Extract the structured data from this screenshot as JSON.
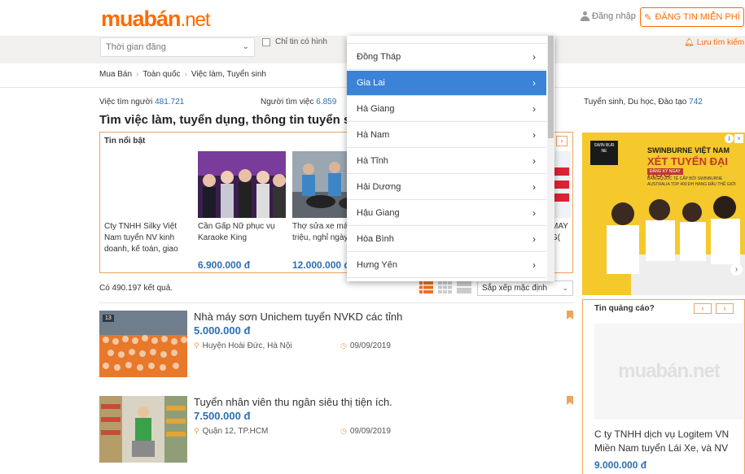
{
  "header": {
    "logo_main": "muabán",
    "logo_suffix": ".net",
    "login_label": "Đăng nhập",
    "post_button_label": "ĐĂNG TIN MIỄN PHÍ"
  },
  "filters": {
    "time_select_value": "Thời gian đăng",
    "photo_only_label": "Chỉ tin có hình",
    "save_search_label": "Lưu tìm kiếm"
  },
  "breadcrumb": [
    "Mua Bán",
    "Toàn quốc",
    "Việc làm, Tuyển sinh"
  ],
  "stats": [
    {
      "label": "Việc tìm người",
      "value": "481.721"
    },
    {
      "label": "Người tìm việc",
      "value": "6.859"
    },
    {
      "label": "Tuyển sinh, Du học, Đào tạo",
      "value": "742"
    }
  ],
  "page_title": "Tìm việc làm, tuyển dụng, thông tin tuyển sinh",
  "featured": {
    "label": "Tin nổi bật",
    "items": [
      {
        "title": "Cty TNHH Silky Việt Nam tuyển NV kinh doanh, kế toán, giao",
        "price": ""
      },
      {
        "title": "Cần Gấp Nữ phục vụ Karaoke King",
        "price": "6.900.000 đ"
      },
      {
        "title": "Thợ sửa xe máy trên 12 triệu, nghỉ ngày/tuần, có",
        "price": "12.000.000 đ"
      }
    ],
    "peek_text": "MAY G(",
    "next_label": "›"
  },
  "results": {
    "count_label": "Có 490.197 kết quả.",
    "sort_value": "Sắp xếp mặc định"
  },
  "listings": [
    {
      "title": "Nhà máy sơn Unichem tuyển NVKD các tỉnh",
      "price": "5.000.000 đ",
      "location": "Huyện Hoài Đức, Hà Nội",
      "date": "09/09/2019",
      "badge": "13"
    },
    {
      "title": "Tuyển nhân viên thu ngân siêu thị tiện ích.",
      "price": "7.500.000 đ",
      "location": "Quận 12, TP.HCM",
      "date": "09/09/2019",
      "badge": ""
    }
  ],
  "ad": {
    "logo_text": "SWIN BUR NE",
    "line1": "SWINBURNE VIỆT NAM",
    "line2": "XÉT TUYỂN ĐẠI HỌC",
    "line3": "ĐĂNG KÝ NGAY",
    "line4": "BẰNG QUỐC TẾ CẤP BỞI SWINBURNE AUSTRALIA TOP 400 ĐH HÀNG ĐẦU THẾ GIỚI",
    "info_label": "i",
    "close_label": "×"
  },
  "side_box": {
    "label": "Tin quảng cáo?",
    "prev_label": "‹",
    "next_label": "›",
    "placeholder": "muabán.net",
    "title": "C ty TNHH dịch vụ Logitem VN Miền Nam tuyển Lái Xe, và NV",
    "price": "9.000.000 đ"
  },
  "province_dropdown": {
    "items": [
      {
        "label": "Đồng Tháp",
        "active": false
      },
      {
        "label": "Gia Lai",
        "active": true
      },
      {
        "label": "Hà Giang",
        "active": false
      },
      {
        "label": "Hà Nam",
        "active": false
      },
      {
        "label": "Hà Tĩnh",
        "active": false
      },
      {
        "label": "Hải Dương",
        "active": false
      },
      {
        "label": "Hậu Giang",
        "active": false
      },
      {
        "label": "Hòa Bình",
        "active": false
      },
      {
        "label": "Hưng Yên",
        "active": false
      }
    ]
  },
  "colors": {
    "accent": "#ff6a00",
    "link_blue": "#2a6fb5",
    "dropdown_active": "#3a83d8",
    "border_orange": "#f0a35e"
  }
}
